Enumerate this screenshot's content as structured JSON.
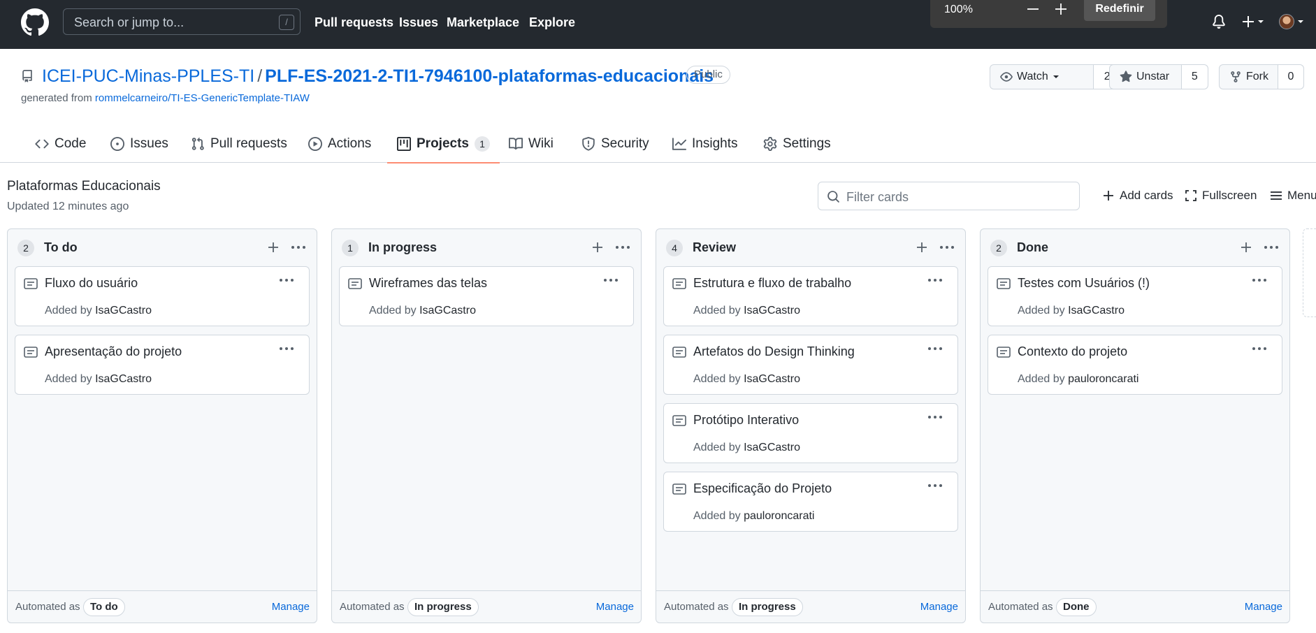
{
  "header": {
    "search_placeholder": "Search or jump to...",
    "search_shortcut": "/",
    "nav": [
      "Pull requests",
      "Issues",
      "Marketplace",
      "Explore"
    ],
    "zoom": {
      "value": "100%",
      "reset_label": "Redefinir"
    }
  },
  "repo": {
    "owner": "ICEI-PUC-Minas-PPLES-TI",
    "separator": "/",
    "name": "PLF-ES-2021-2-TI1-7946100-plataformas-educacionais",
    "visibility": "Public",
    "generated_prefix": "generated from",
    "generated_link": "rommelcarneiro/TI-ES-GenericTemplate-TIAW",
    "watch": {
      "label": "Watch",
      "count": "2"
    },
    "star": {
      "label": "Unstar",
      "count": "5"
    },
    "fork": {
      "label": "Fork",
      "count": "0"
    }
  },
  "tabs": [
    {
      "label": "Code"
    },
    {
      "label": "Issues"
    },
    {
      "label": "Pull requests"
    },
    {
      "label": "Actions"
    },
    {
      "label": "Projects",
      "count": "1"
    },
    {
      "label": "Wiki"
    },
    {
      "label": "Security"
    },
    {
      "label": "Insights"
    },
    {
      "label": "Settings"
    }
  ],
  "project": {
    "name": "Plataformas Educacionais",
    "updated": "Updated 12 minutes ago",
    "filter_placeholder": "Filter cards",
    "add_cards": "Add cards",
    "fullscreen": "Fullscreen",
    "menu": "Menu"
  },
  "columns": [
    {
      "count": "2",
      "title": "To do",
      "cards": [
        {
          "title": "Fluxo do usuário",
          "added": "Added by",
          "by": "IsaGCastro"
        },
        {
          "title": "Apresentação do projeto",
          "added": "Added by",
          "by": "IsaGCastro"
        }
      ],
      "automated_label": "Automated as",
      "automated_value": "To do",
      "manage": "Manage"
    },
    {
      "count": "1",
      "title": "In progress",
      "cards": [
        {
          "title": "Wireframes das telas",
          "added": "Added by",
          "by": "IsaGCastro"
        }
      ],
      "automated_label": "Automated as",
      "automated_value": "In progress",
      "manage": "Manage"
    },
    {
      "count": "4",
      "title": "Review",
      "cards": [
        {
          "title": "Estrutura e fluxo de trabalho",
          "added": "Added by",
          "by": "IsaGCastro"
        },
        {
          "title": "Artefatos do Design Thinking",
          "added": "Added by",
          "by": "IsaGCastro"
        },
        {
          "title": "Protótipo Interativo",
          "added": "Added by",
          "by": "IsaGCastro"
        },
        {
          "title": "Especificação do Projeto",
          "added": "Added by",
          "by": "pauloroncarati"
        }
      ],
      "automated_label": "Automated as",
      "automated_value": "In progress",
      "manage": "Manage"
    },
    {
      "count": "2",
      "title": "Done",
      "cards": [
        {
          "title": "Testes com Usuários (!)",
          "added": "Added by",
          "by": "IsaGCastro"
        },
        {
          "title": "Contexto do projeto",
          "added": "Added by",
          "by": "pauloroncarati"
        }
      ],
      "automated_label": "Automated as",
      "automated_value": "Done",
      "manage": "Manage"
    }
  ]
}
